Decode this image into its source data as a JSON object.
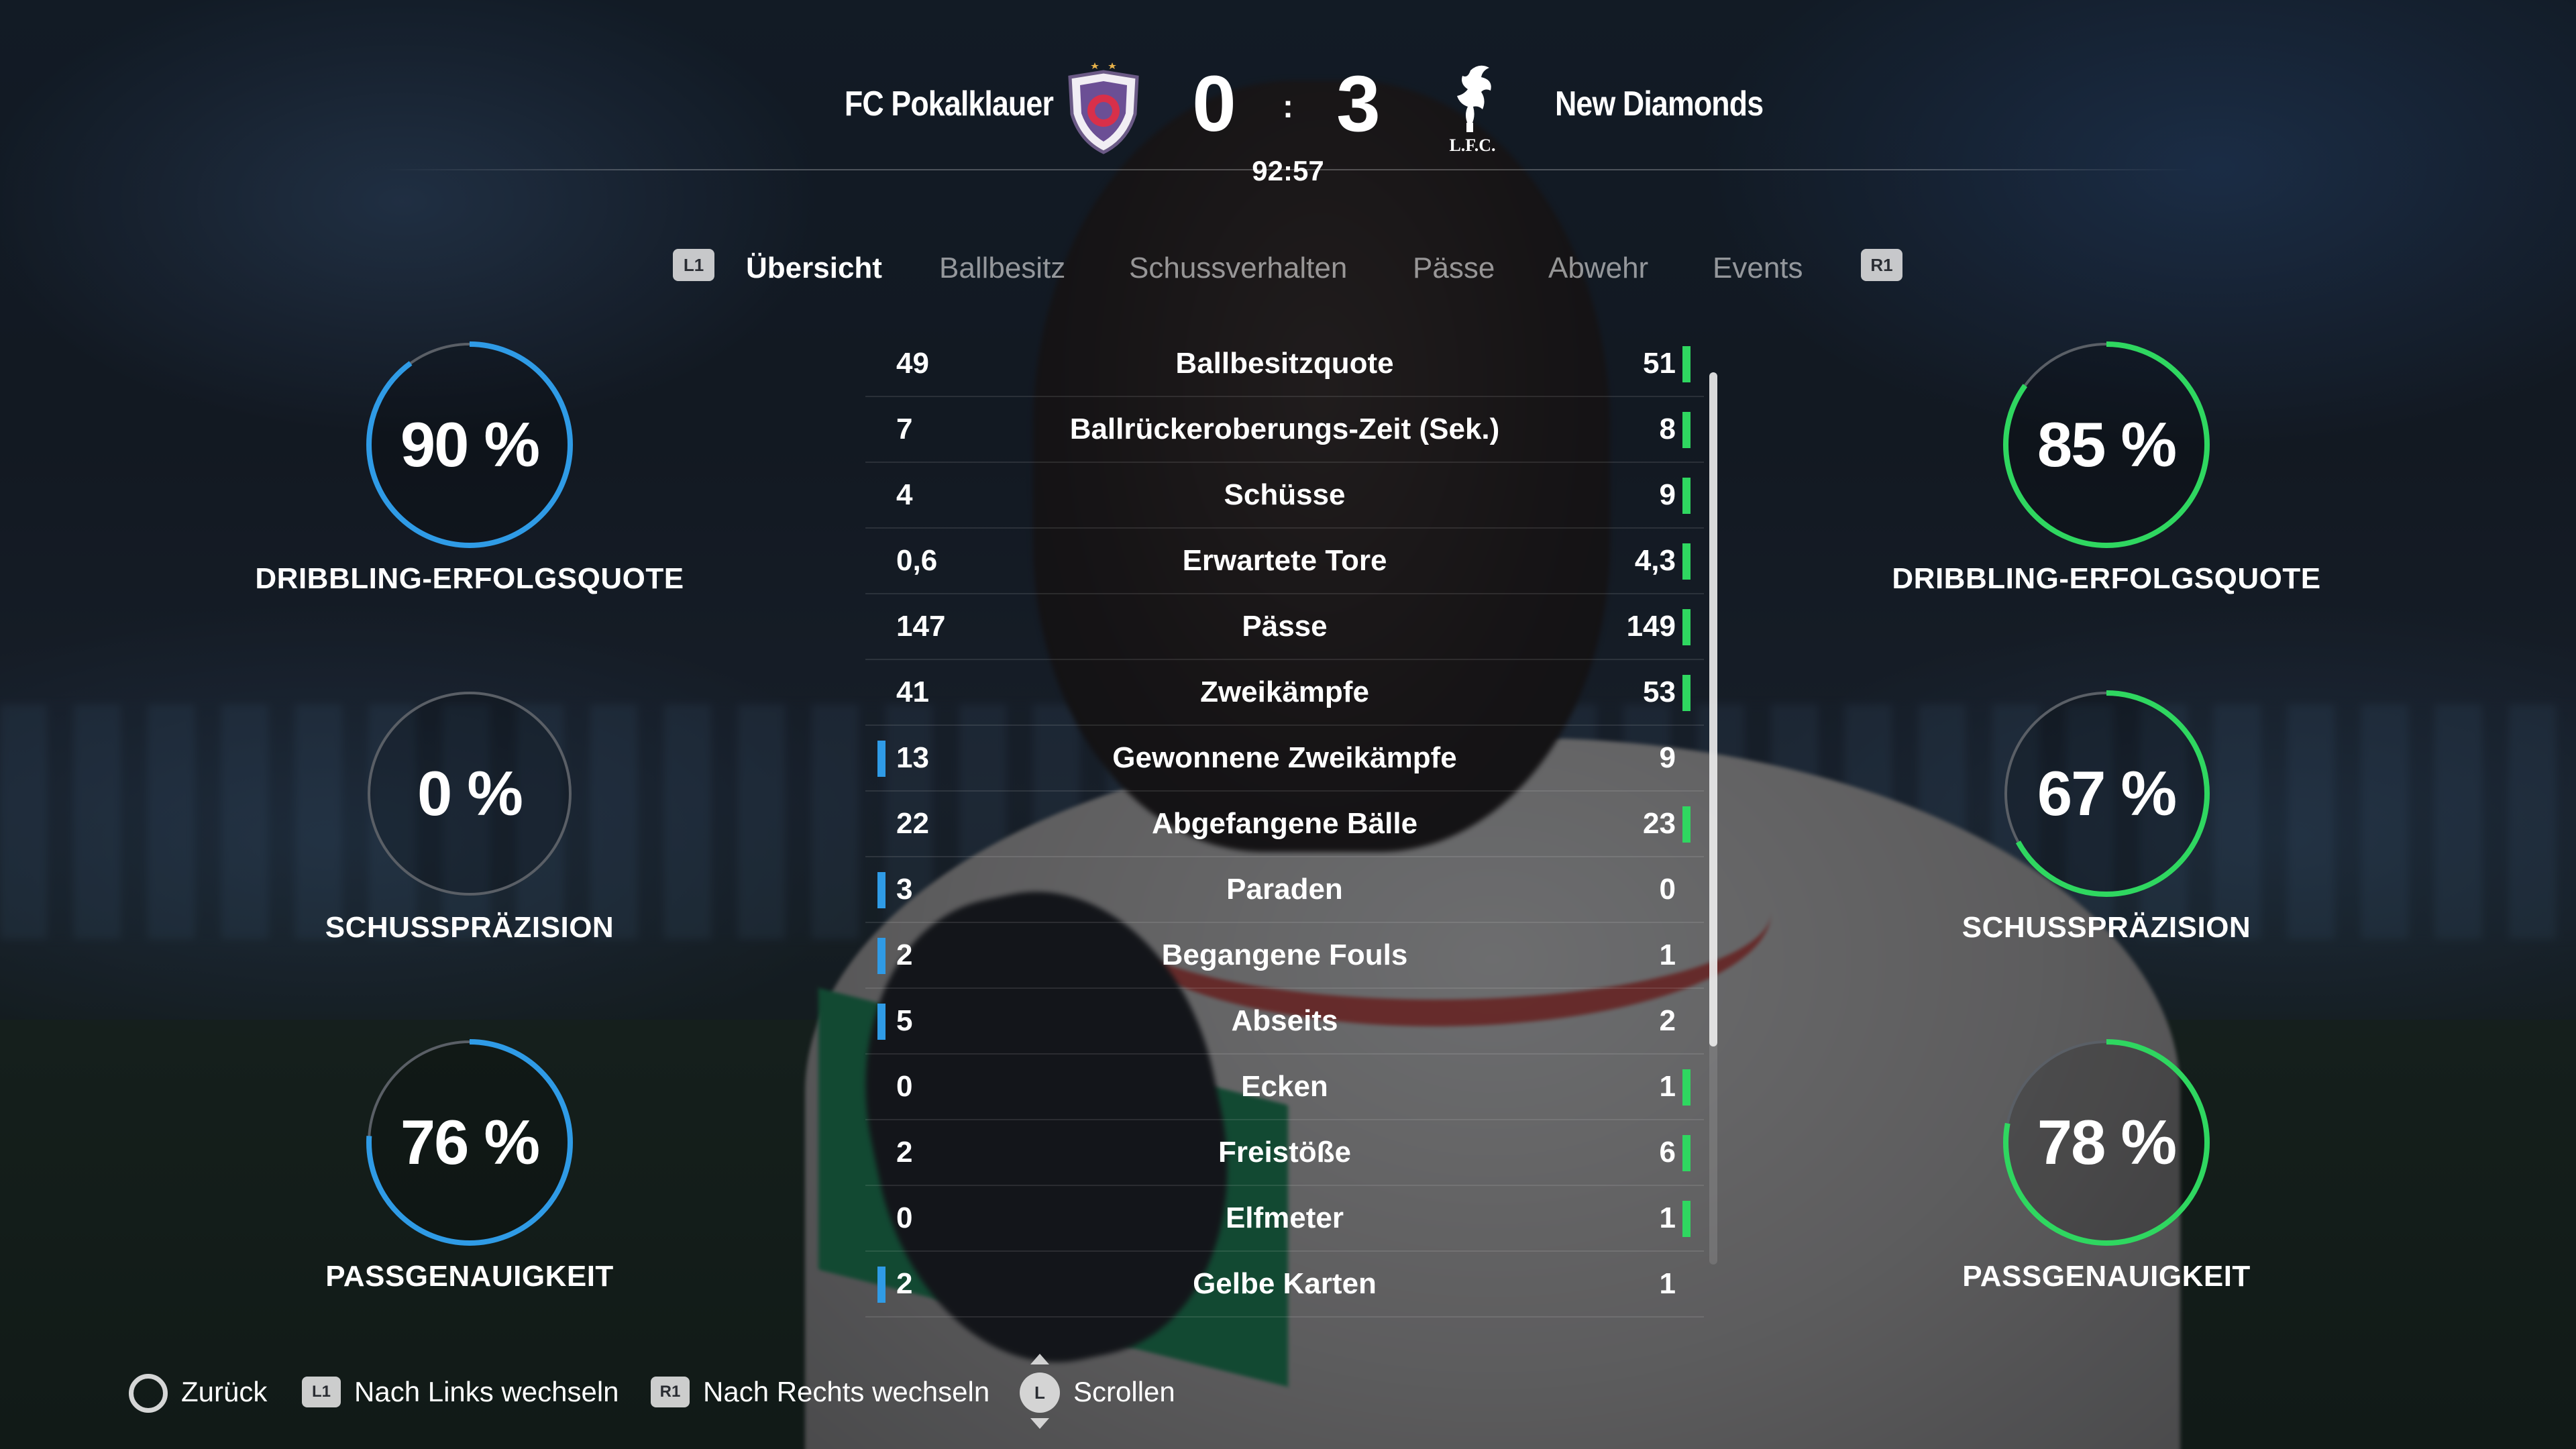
{
  "header": {
    "home_team": "FC Pokalklauer",
    "away_team": "New Diamonds",
    "home_score": "0",
    "away_score": "3",
    "separator": ":",
    "clock": "92:57",
    "away_crest_text": "L.F.C."
  },
  "tabs": {
    "prev_button": "L1",
    "next_button": "R1",
    "items": [
      "Übersicht",
      "Ballbesitz",
      "Schussverhalten",
      "Pässe",
      "Abwehr",
      "Events"
    ],
    "active": "Übersicht"
  },
  "home_rings": [
    {
      "value": "90 %",
      "fraction": 0.9,
      "label": "DRIBBLING-ERFOLGSQUOTE"
    },
    {
      "value": "0 %",
      "fraction": 0.0,
      "label": "SCHUSSPRÄZISION"
    },
    {
      "value": "76 %",
      "fraction": 0.76,
      "label": "PASSGENAUIGKEIT"
    }
  ],
  "away_rings": [
    {
      "value": "85 %",
      "fraction": 0.85,
      "label": "DRIBBLING-ERFOLGSQUOTE"
    },
    {
      "value": "67 %",
      "fraction": 0.67,
      "label": "SCHUSSPRÄZISION"
    },
    {
      "value": "78 %",
      "fraction": 0.78,
      "label": "PASSGENAUIGKEIT"
    }
  ],
  "stats": [
    {
      "name": "Ballbesitzquote",
      "home": "49",
      "away": "51",
      "lead": "away"
    },
    {
      "name": "Ballrückeroberungs-Zeit (Sek.)",
      "home": "7",
      "away": "8",
      "lead": "away"
    },
    {
      "name": "Schüsse",
      "home": "4",
      "away": "9",
      "lead": "away"
    },
    {
      "name": "Erwartete Tore",
      "home": "0,6",
      "away": "4,3",
      "lead": "away"
    },
    {
      "name": "Pässe",
      "home": "147",
      "away": "149",
      "lead": "away"
    },
    {
      "name": "Zweikämpfe",
      "home": "41",
      "away": "53",
      "lead": "away"
    },
    {
      "name": "Gewonnene Zweikämpfe",
      "home": "13",
      "away": "9",
      "lead": "home"
    },
    {
      "name": "Abgefangene Bälle",
      "home": "22",
      "away": "23",
      "lead": "away"
    },
    {
      "name": "Paraden",
      "home": "3",
      "away": "0",
      "lead": "home"
    },
    {
      "name": "Begangene Fouls",
      "home": "2",
      "away": "1",
      "lead": "home"
    },
    {
      "name": "Abseits",
      "home": "5",
      "away": "2",
      "lead": "home"
    },
    {
      "name": "Ecken",
      "home": "0",
      "away": "1",
      "lead": "away"
    },
    {
      "name": "Freistöße",
      "home": "2",
      "away": "6",
      "lead": "away"
    },
    {
      "name": "Elfmeter",
      "home": "0",
      "away": "1",
      "lead": "away"
    },
    {
      "name": "Gelbe Karten",
      "home": "2",
      "away": "1",
      "lead": "home"
    }
  ],
  "footer": {
    "back": "Zurück",
    "left_btn": "L1",
    "left_label": "Nach Links wechseln",
    "right_btn": "R1",
    "right_label": "Nach Rechts wechseln",
    "stick": "L",
    "scroll_label": "Scrollen"
  },
  "colors": {
    "home_accent": "#2f9be6",
    "away_accent": "#2fd760",
    "ring_track": "#5a5f66"
  },
  "icons": {
    "back": "circle-button-icon",
    "scroll": "left-stick-icon"
  }
}
